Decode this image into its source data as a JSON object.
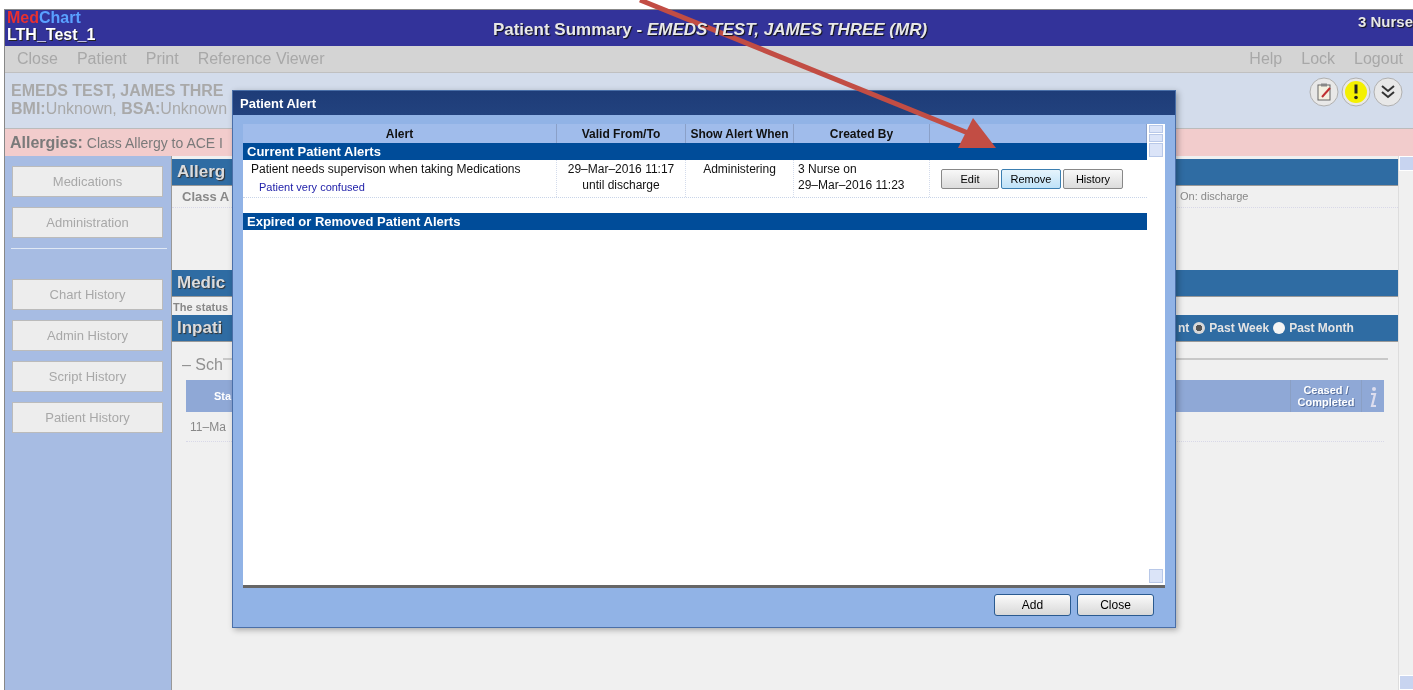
{
  "app": {
    "logo_left": "Med",
    "logo_right": "Chart",
    "site": "LTH_Test_1",
    "title": "Patient Summary - *EMEDS TEST, JAMES THREE (MR)*",
    "user": "3 Nurse"
  },
  "menu_left": [
    "Close",
    "Patient",
    "Print",
    "Reference Viewer"
  ],
  "menu_right": [
    "Help",
    "Lock",
    "Logout"
  ],
  "patient": {
    "line1": "EMEDS TEST, JAMES THRE",
    "line2": "**BMI:**Unknown, **BSA:**Unknown"
  },
  "allergies": {
    "label": "Allergies:",
    "text": "Class Allergy to ACE I"
  },
  "sidebar": {
    "top": [
      "Medications",
      "Administration"
    ],
    "bottom": [
      "Chart History",
      "Admin History",
      "Script History",
      "Patient History"
    ]
  },
  "main": {
    "allergy_heading": "Allerg",
    "allergy_text": "Class A",
    "allergy_detail": "On: discharge",
    "med_heading": "Medic",
    "status_text": "The status",
    "inpatient_heading": "Inpati",
    "periods": [
      {
        "label": "nt"
      },
      {
        "label": "Past Week",
        "selected": true
      },
      {
        "label": "Past Month",
        "selected": false
      }
    ],
    "schedule_heading": "– Sch",
    "table_first_col": "Sta",
    "table_last_col": "Ceased / Completed",
    "first_cell": "11–Ma"
  },
  "dialog": {
    "title": "Patient Alert",
    "columns": [
      "Alert",
      "Valid From/To",
      "Show Alert When",
      "Created By"
    ],
    "sections": [
      {
        "title": "Current Patient Alerts",
        "rows": [
          {
            "alert": "Patient needs supervison when taking Medications",
            "note": "Patient very confused",
            "valid_from": "29–Mar–2016 11:17",
            "valid_to": "until discharge",
            "show_when": "Administering",
            "created_by": "3 Nurse on",
            "created_at": "29–Mar–2016 11:23",
            "actions": [
              {
                "label": "Edit",
                "highlighted": false
              },
              {
                "label": "Remove",
                "highlighted": true
              },
              {
                "label": "History",
                "highlighted": false
              }
            ]
          }
        ]
      },
      {
        "title": "Expired or Removed Patient Alerts"
      }
    ],
    "buttons": [
      "Add",
      "Close"
    ]
  }
}
